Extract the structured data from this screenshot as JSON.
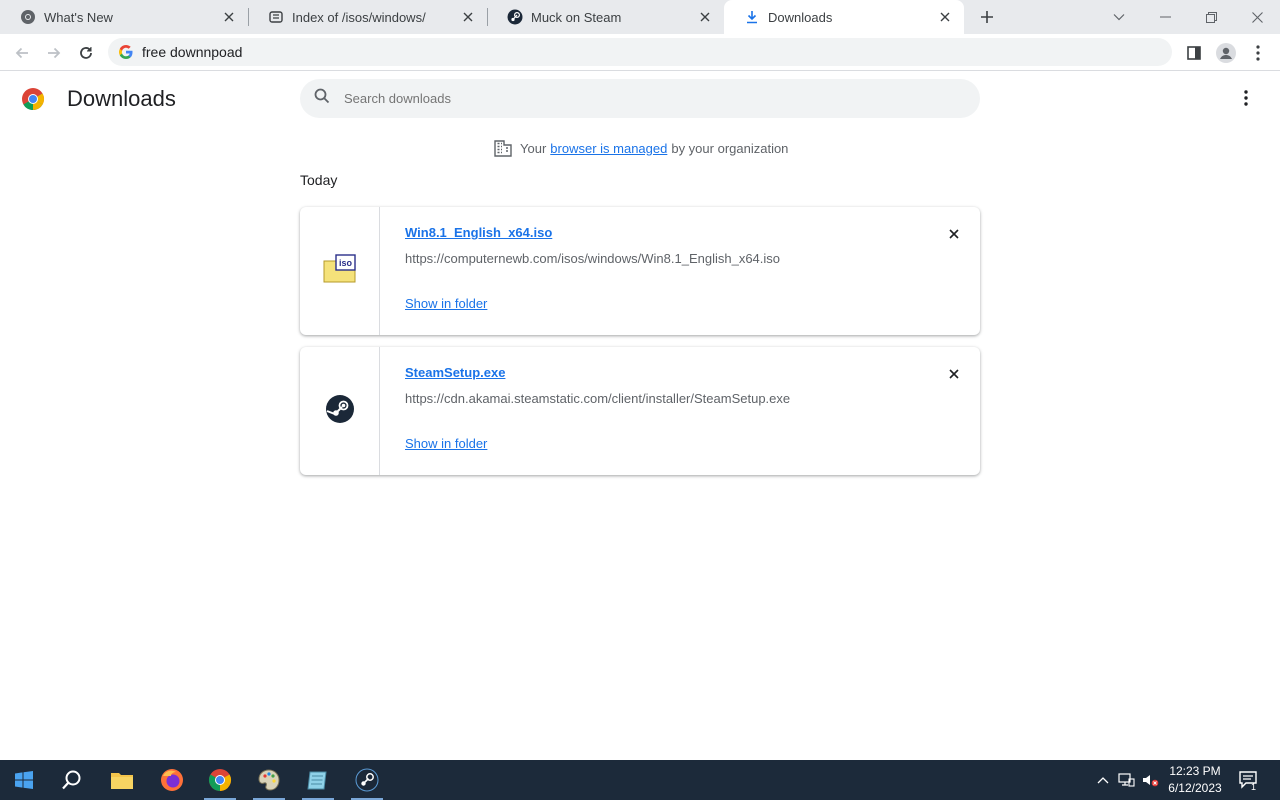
{
  "tabs": [
    {
      "title": "What's New",
      "icon": "chrome-icon"
    },
    {
      "title": "Index of /isos/windows/",
      "icon": "server-icon"
    },
    {
      "title": "Muck on Steam",
      "icon": "steam-icon"
    },
    {
      "title": "Downloads",
      "icon": "download-icon",
      "active": true
    }
  ],
  "toolbar": {
    "address_value": "free downnpoad"
  },
  "page": {
    "title": "Downloads",
    "search_placeholder": "Search downloads",
    "managed": {
      "prefix": "Your",
      "link": "browser is managed",
      "suffix": "by your organization"
    },
    "section_label": "Today",
    "downloads": [
      {
        "file_name": "Win8.1_English_x64.iso",
        "url": "https://computernewb.com/isos/windows/Win8.1_English_x64.iso",
        "action": "Show in folder",
        "icon": "iso-file-icon"
      },
      {
        "file_name": "SteamSetup.exe",
        "url": "https://cdn.akamai.steamstatic.com/client/installer/SteamSetup.exe",
        "action": "Show in folder",
        "icon": "steam-icon"
      }
    ]
  },
  "taskbar": {
    "time": "12:23 PM",
    "date": "6/12/2023",
    "notification_count": "1"
  },
  "colors": {
    "link": "#1a73e8",
    "taskbar": "#1c2a3a",
    "tabstrip": "#e8eaed"
  }
}
